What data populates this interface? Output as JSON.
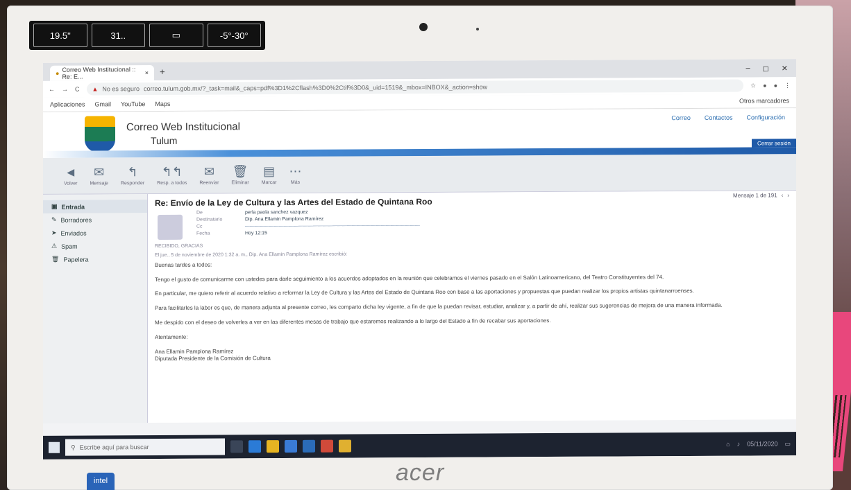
{
  "bezel": {
    "badges": [
      "19.5\"",
      "31..",
      "",
      "-5°-30°"
    ],
    "brand": "acer",
    "intel": "intel"
  },
  "browser": {
    "tab_title": "Correo Web Institucional :: Re: E...",
    "tab_close": "×",
    "new_tab": "+",
    "url_warning": "No es seguro",
    "url": "correo.tulum.gob.mx/?_task=mail&_caps=pdf%3D1%2Cflash%3D0%2Ctif%3D0&_uid=1519&_mbox=INBOX&_action=show",
    "bookmarks": [
      "Aplicaciones",
      "Gmail",
      "YouTube",
      "Maps"
    ],
    "other_bookmarks": "Otros marcadores"
  },
  "header": {
    "title_line1": "Correo Web Institucional",
    "title_line2": "Tulum",
    "links": [
      "Correo",
      "Contactos",
      "Configuración"
    ],
    "logout": "Cerrar sesión"
  },
  "toolbar": {
    "buttons": [
      "Volver",
      "Mensaje",
      "Responder",
      "Resp. a todos",
      "Reenviar",
      "Eliminar",
      "Marcar",
      "Más"
    ]
  },
  "folders": [
    "Entrada",
    "Borradores",
    "Enviados",
    "Spam",
    "Papelera"
  ],
  "message": {
    "subject": "Re: Envío de la Ley de Cultura y las Artes del Estado de Quintana Roo",
    "pager": "Mensaje 1 de 191",
    "from_value": "perla paola sanchez vazquez",
    "to_value": "Dip. Ana Ellamin Pamplona Ramírez",
    "date_value": "Hoy 12:15",
    "greeting": "RECIBIDO, GRACIAS",
    "quote": "El jue., 5 de noviembre de 2020 1:32 a. m., Dip. Ana Ellamin Pamplona Ramírez escribió:",
    "paragraphs": [
      "Buenas tardes a todos:",
      "Tengo el gusto de comunicarme con ustedes para darle seguimiento a los acuerdos adoptados en la reunión que celebramos el viernes pasado en el Salón Latinoamericano, del Teatro Constituyentes del 74.",
      "En particular, me quiero referir al acuerdo relativo a reformar la Ley de Cultura y las Artes del Estado de Quintana Roo con base a las aportaciones y propuestas que puedan realizar los propios artistas quintanarroenses.",
      "Para facilitarles la labor es que, de manera adjunta al presente correo, les comparto dicha ley vigente, a fin de que la puedan revisar, estudiar, analizar y, a partir de ahí, realizar sus sugerencias de mejora de una manera informada.",
      "Me despido con el deseo de volverles a ver en las diferentes mesas de trabajo que estaremos realizando a lo largo del Estado a fin de recabar sus aportaciones.",
      "Atentamente:",
      "Ana Ellamin Pamplona Ramírez",
      "Diputada Presidente de la Comisión de Cultura"
    ]
  },
  "taskbar": {
    "search_placeholder": "Escribe aquí para buscar",
    "date": "05/11/2020"
  }
}
